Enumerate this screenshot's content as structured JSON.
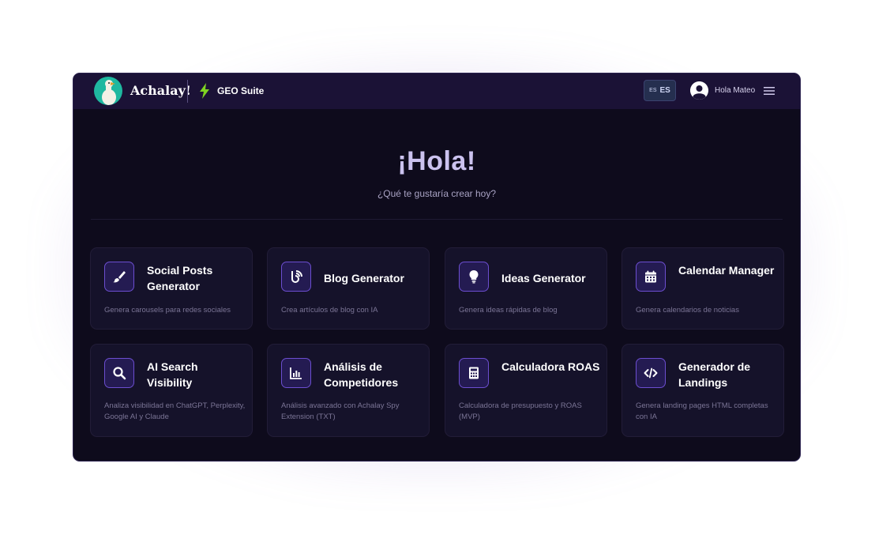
{
  "header": {
    "brand": "Achalay!",
    "suite": "GEO Suite",
    "lang_small": "ES",
    "lang_big": "ES",
    "user_greeting": "Hola Mateo"
  },
  "hero": {
    "title": "¡Hola!",
    "subtitle": "¿Qué te gustaría crear hoy?"
  },
  "cards": [
    {
      "icon": "brush-icon",
      "title": "Social Posts Generator",
      "desc": "Genera carousels para redes sociales"
    },
    {
      "icon": "blog-icon",
      "title": "Blog Generator",
      "desc": "Crea artículos de blog con IA"
    },
    {
      "icon": "lightbulb-icon",
      "title": "Ideas Generator",
      "desc": "Genera ideas rápidas de blog"
    },
    {
      "icon": "calendar-icon",
      "title": "Calendar Manager",
      "desc": "Genera calendarios de noticias"
    },
    {
      "icon": "search-icon",
      "title": "AI Search Visibility",
      "desc": "Analiza visibilidad en ChatGPT, Perplexity, Google AI y Claude"
    },
    {
      "icon": "chart-icon",
      "title": "Análisis de Competidores",
      "desc": "Análisis avanzado con Achalay Spy Extension (TXT)"
    },
    {
      "icon": "calculator-icon",
      "title": "Calculadora ROAS",
      "desc": "Calculadora de presupuesto y ROAS (MVP)"
    },
    {
      "icon": "code-icon",
      "title": "Generador de Landings",
      "desc": "Genera landing pages HTML completas con IA"
    }
  ],
  "colors": {
    "background": "#0e0b1c",
    "topbar": "#1b1236",
    "accent": "#6c4ed0",
    "bolt": "#7ed321",
    "logo": "#1fb8a0"
  }
}
